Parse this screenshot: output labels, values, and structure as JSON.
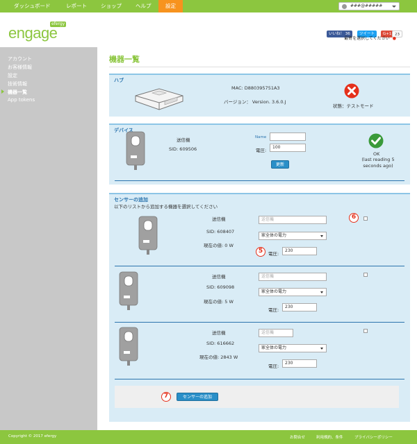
{
  "topnav": {
    "items": [
      {
        "label": "ダッシュボード"
      },
      {
        "label": "レポート"
      },
      {
        "label": "ショップ"
      },
      {
        "label": "ヘルプ"
      },
      {
        "label": "設定"
      }
    ],
    "user": "###@#####",
    "colors": {
      "bar": "#8cc63f",
      "active": "#f7931e"
    }
  },
  "header": {
    "logo": "engage",
    "logo_badge": "efergy",
    "social": {
      "like": "いいね！ 36",
      "tweet": "ツイート",
      "gplus": "G+1",
      "gplus_count": "23"
    },
    "select_prompt": "最寄を選択してください",
    "select_mark": "●"
  },
  "sidebar": {
    "items": [
      {
        "label": "アカウント"
      },
      {
        "label": "お客様情報"
      },
      {
        "label": "設定"
      },
      {
        "label": "技術情報"
      },
      {
        "label": "機器一覧"
      },
      {
        "label": "App tokens"
      }
    ]
  },
  "page": {
    "title": "機器一覧"
  },
  "hub": {
    "title": "ハブ",
    "mac": "MAC: D880395751A3",
    "version": "バージョン： Version. 3.6.0.J",
    "status": "状態：テストモード",
    "status_color": "#e5301b"
  },
  "device": {
    "title": "デバイス",
    "type": "送信機",
    "sid": "SID: 609506",
    "name_label": "Name",
    "name_value": "",
    "voltage_label": "電圧:",
    "voltage_value": "100",
    "update_button": "更新",
    "ok": "OK",
    "last_reading": "(last reading 5 seconds ago)",
    "ok_color": "#3a9a3a"
  },
  "sensors": {
    "title": "センサーの追加",
    "subtitle": "以下のリストから追加する機器を選択してください",
    "type_placeholder": "送信機",
    "select_value": "家全体の電力",
    "voltage_label": "電圧:",
    "add_button": "センサーの追加",
    "items": [
      {
        "type": "送信機",
        "sid": "SID: 608407",
        "current": "現在の値: 0 W",
        "voltage": "230"
      },
      {
        "type": "送信機",
        "sid": "SID: 609098",
        "current": "現在の値: 5 W",
        "voltage": "230"
      },
      {
        "type": "送信機",
        "sid": "SID: 616662",
        "current": "現在の値: 2843 W",
        "voltage": "230"
      }
    ],
    "callouts": {
      "five": "5",
      "six": "6",
      "seven": "7"
    }
  },
  "footer": {
    "copyright": "Copyright © 2017 efergy",
    "links": [
      {
        "label": "お問合せ"
      },
      {
        "label": "利用規約、条件"
      },
      {
        "label": "プライバシーポリシー"
      }
    ]
  }
}
